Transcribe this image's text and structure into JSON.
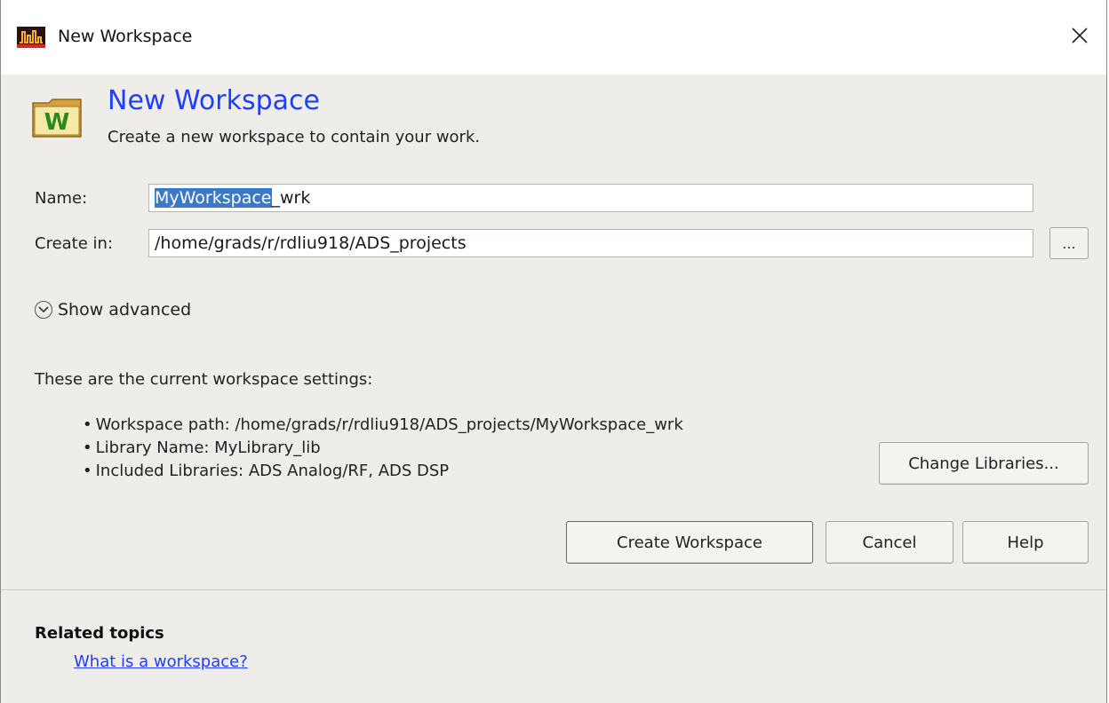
{
  "window": {
    "title": "New Workspace",
    "icon": "ads-app-icon"
  },
  "header": {
    "title": "New Workspace",
    "subtitle": "Create a new workspace to contain your work.",
    "icon": "workspace-folder-icon"
  },
  "form": {
    "name_label": "Name:",
    "name_value_selected": "MyWorkspace",
    "name_value_rest": "_wrk",
    "create_in_label": "Create in:",
    "create_in_value": "/home/grads/r/rdliu918/ADS_projects",
    "browse_label": "..."
  },
  "advanced": {
    "label": "Show advanced",
    "icon": "chevron-down-circle-icon"
  },
  "settings": {
    "intro": "These are the current workspace settings:",
    "items": [
      "Workspace path:  /home/grads/r/rdliu918/ADS_projects/MyWorkspace_wrk",
      "Library Name:  MyLibrary_lib",
      "Included Libraries:  ADS Analog/RF, ADS DSP"
    ],
    "change_libraries_label": "Change Libraries..."
  },
  "buttons": {
    "create": "Create Workspace",
    "cancel": "Cancel",
    "help": "Help"
  },
  "related": {
    "title": "Related topics",
    "link": "What is a workspace?"
  },
  "colors": {
    "heading_blue": "#1f3fff",
    "selection_blue": "#3b79c7",
    "dialog_bg": "#efedea",
    "link_blue": "#1f3fff"
  }
}
